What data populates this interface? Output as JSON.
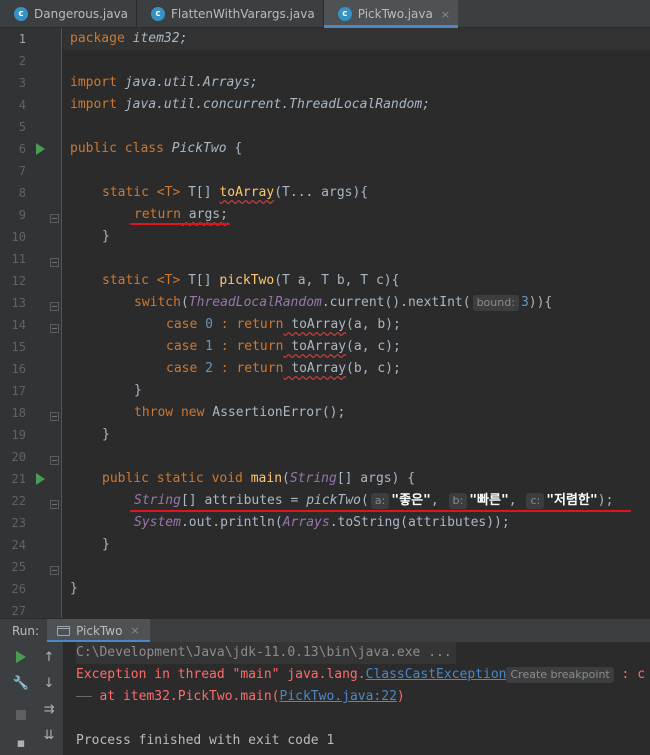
{
  "tabs": [
    {
      "label": "Dangerous.java",
      "icon": "java-class-icon",
      "active": false
    },
    {
      "label": "FlattenWithVarargs.java",
      "icon": "java-class-icon",
      "active": false
    },
    {
      "label": "PickTwo.java",
      "icon": "java-class-icon",
      "active": true,
      "close": "×"
    }
  ],
  "class_icon_letter": "c",
  "line_numbers": [
    "1",
    "2",
    "3",
    "4",
    "5",
    "6",
    "7",
    "8",
    "9",
    "10",
    "11",
    "12",
    "13",
    "14",
    "15",
    "16",
    "17",
    "18",
    "19",
    "20",
    "21",
    "22",
    "23",
    "24",
    "25",
    "26",
    "27"
  ],
  "code": {
    "l1": {
      "kw": "package",
      "rest": " item32;"
    },
    "l3": {
      "kw": "import",
      "rest": " java.util.Arrays;"
    },
    "l4": {
      "kw": "import",
      "rest": " java.util.concurrent.ThreadLocalRandom;"
    },
    "l6": {
      "kw": "public class",
      "name": " PickTwo",
      "rest": " {"
    },
    "l8": {
      "kw": "static",
      "t": "<T>",
      "ret": " T[] ",
      "meth": "toArray",
      "params": "(T... args){"
    },
    "l9": {
      "kw": "return",
      "rest": " args;"
    },
    "l10": "}",
    "l12": {
      "kw": "static",
      "t": "<T>",
      "ret": " T[] ",
      "meth": "pickTwo",
      "params": "(T a, T b, T c){"
    },
    "l13": {
      "kw": "switch",
      "pre": "(",
      "cls": "ThreadLocalRandom",
      "mid": ".current().nextInt(",
      "hint": "bound:",
      "num": "3",
      "post": ")){"
    },
    "l14": {
      "kw": "case",
      "num": " 0",
      "kw2": " : return",
      "call": " toArray",
      "args": "(a, b);"
    },
    "l15": {
      "kw": "case",
      "num": " 1",
      "kw2": " : return",
      "call": " toArray",
      "args": "(a, c);"
    },
    "l16": {
      "kw": "case",
      "num": " 2",
      "kw2": " : return",
      "call": " toArray",
      "args": "(b, c);"
    },
    "l17": "}",
    "l18": {
      "kw": "throw new",
      "rest": " AssertionError();"
    },
    "l19": "}",
    "l21": {
      "kw": "public static void",
      "meth": " main",
      "pre": "(",
      "cls": "String",
      "rest": "[] args) {"
    },
    "l22": {
      "cls": "String",
      "mid": "[] attributes = ",
      "call": "pickTwo",
      "p": "(",
      "h1": "a:",
      "s1": "\"좋은\"",
      "h2": "b:",
      "s2": "\"빠른\"",
      "h3": "c:",
      "s3": "\"저렴한\"",
      "end": ");"
    },
    "l23": {
      "cls": "System",
      "mid": ".out.println(",
      "cls2": "Arrays",
      "rest": ".toString(attributes));"
    },
    "l24": "}",
    "l26": "}"
  },
  "run_window": {
    "label": "Run:",
    "tab_label": "PickTwo",
    "tab_close": "×",
    "console": {
      "cmd": "C:\\Development\\Java\\jdk-11.0.13\\bin\\java.exe ...",
      "err_prefix": "Exception in thread \"main\" java.lang.",
      "err_link": "ClassCastException",
      "bp_hint": "Create breakpoint",
      "err_suffix": " : c",
      "trace_prefix": "at item32.PickTwo.main(",
      "trace_link": "PickTwo.java:22",
      "trace_suffix": ")",
      "finish": "Process finished with exit code 1"
    }
  },
  "colors": {
    "accent_tab": "#4a88c7",
    "run_green": "#499c54",
    "annotation_red": "#e0151b",
    "error_text": "#ff6b68"
  }
}
